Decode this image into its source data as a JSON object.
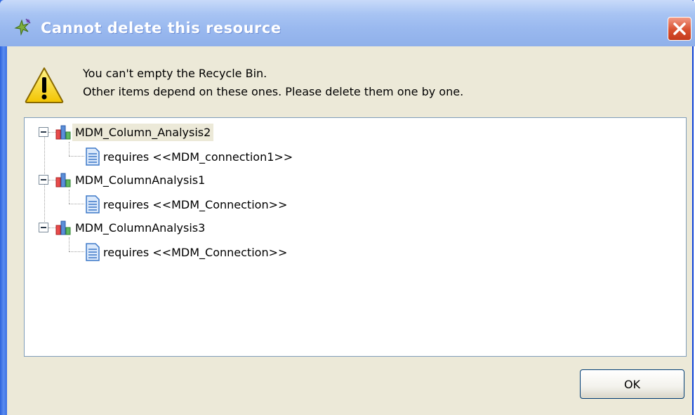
{
  "dialog": {
    "title": "Cannot delete this resource",
    "message_line1": "You can't empty the Recycle Bin.",
    "message_line2": "Other items depend on these ones. Please delete them one by one.",
    "ok_label": "OK"
  },
  "tree": {
    "items": [
      {
        "label": "MDM_Column_Analysis2",
        "selected": true,
        "child": "requires <<MDM_connection1>>"
      },
      {
        "label": "MDM_ColumnAnalysis1",
        "selected": false,
        "child": "requires <<MDM_Connection>>"
      },
      {
        "label": "MDM_ColumnAnalysis3",
        "selected": false,
        "child": "requires <<MDM_Connection>>"
      }
    ]
  },
  "colors": {
    "titlebar": "#9ab9ef",
    "dialog_bg": "#ece9d8",
    "close_button": "#d8502f"
  },
  "icons": {
    "app": "sparkle-icon",
    "close": "close-icon",
    "warning": "warning-icon",
    "analysis": "bar-chart-icon",
    "dependency": "document-icon"
  }
}
